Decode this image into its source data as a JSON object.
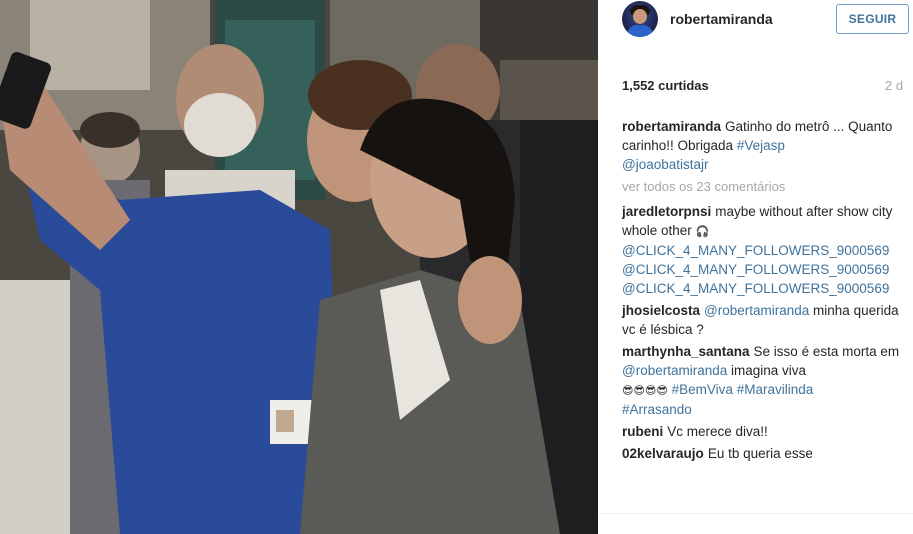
{
  "post": {
    "username": "robertamiranda",
    "follow_label": "SEGUIR",
    "likes": "1,552 curtidas",
    "time_ago": "2 d",
    "caption": {
      "author": "robertamiranda",
      "text": "Gatinho do metrô ... Quanto carinho!! Obrigada ",
      "tag1": "#Vejasp",
      "tag2": "@joaobatistajr"
    },
    "view_all_comments": "ver todos os 23 comentários"
  },
  "comments": [
    {
      "author": "jaredletorpnsi",
      "text": "maybe without after show city whole other",
      "emoji": "🎧",
      "mentions": [
        "@CLICK_4_MANY_FOLLOWERS_9000569",
        "@CLICK_4_MANY_FOLLOWERS_9000569",
        "@CLICK_4_MANY_FOLLOWERS_9000569"
      ]
    },
    {
      "author": "jhosielcosta",
      "mention": "@robertamiranda",
      "text": " minha querida vc é lésbica ?"
    },
    {
      "author": "marthynha_santana",
      "text1": "Se isso é esta morta em ",
      "mention": "@robertamiranda",
      "text2": " imagina viva ",
      "emoji": "😎😎😎😎",
      "tag1": "#BemViva",
      "tag2": "#Maravilinda",
      "tag3": "#Arrasando"
    },
    {
      "author": "rubeni",
      "text": "Vc merece diva!!"
    },
    {
      "author": "02kelvaraujo",
      "text": "Eu tb queria esse"
    }
  ],
  "colors": {
    "accent": "#3f729b",
    "muted": "#a5a7aa",
    "text": "#262626",
    "follow_border": "#70a0d0"
  },
  "icons": {
    "avatar": "profile-photo"
  }
}
